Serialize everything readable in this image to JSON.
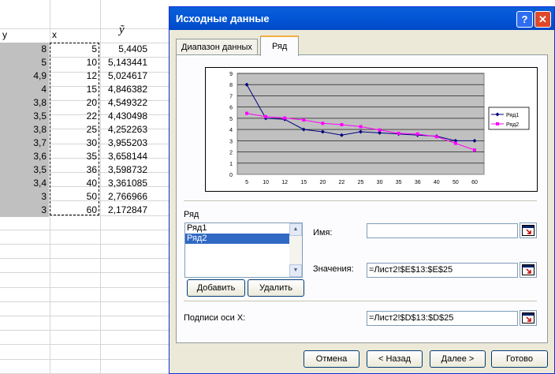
{
  "sheet": {
    "headers": {
      "y": "y",
      "x": "x",
      "yhat": "ỹ"
    },
    "rows": [
      {
        "y": "8",
        "x": "5",
        "yhat": "5,4405"
      },
      {
        "y": "5",
        "x": "10",
        "yhat": "5,143441"
      },
      {
        "y": "4,9",
        "x": "12",
        "yhat": "5,024617"
      },
      {
        "y": "4",
        "x": "15",
        "yhat": "4,846382"
      },
      {
        "y": "3,8",
        "x": "20",
        "yhat": "4,549322"
      },
      {
        "y": "3,5",
        "x": "22",
        "yhat": "4,430498"
      },
      {
        "y": "3,8",
        "x": "25",
        "yhat": "4,252263"
      },
      {
        "y": "3,7",
        "x": "30",
        "yhat": "3,955203"
      },
      {
        "y": "3,6",
        "x": "35",
        "yhat": "3,658144"
      },
      {
        "y": "3,5",
        "x": "36",
        "yhat": "3,598732"
      },
      {
        "y": "3,4",
        "x": "40",
        "yhat": "3,361085"
      },
      {
        "y": "3",
        "x": "50",
        "yhat": "2,766966"
      },
      {
        "y": "3",
        "x": "60",
        "yhat": "2,172847"
      }
    ]
  },
  "dialog": {
    "title": "Исходные данные",
    "help": "?",
    "close": "✕",
    "tabs": [
      "Диапазон данных",
      "Ряд"
    ],
    "series_group_label": "Ряд",
    "series_items": [
      "Ряд1",
      "Ряд2"
    ],
    "selected_series": 1,
    "add_button": "Добавить",
    "remove_button": "Удалить",
    "name_label": "Имя:",
    "name_value": "",
    "values_label": "Значения:",
    "values_value": "=Лист2!$E$13:$E$25",
    "axis_labels_label": "Подписи оси X:",
    "axis_labels_value": "=Лист2!$D$13:$D$25",
    "buttons": {
      "cancel": "Отмена",
      "back": "< Назад",
      "next": "Далее >",
      "finish": "Готово"
    }
  },
  "chart_data": {
    "type": "line",
    "categories": [
      "5",
      "10",
      "12",
      "15",
      "20",
      "22",
      "25",
      "30",
      "35",
      "36",
      "40",
      "50",
      "60"
    ],
    "ylim": [
      0,
      9
    ],
    "yticks": [
      "0",
      "1",
      "2",
      "3",
      "4",
      "5",
      "6",
      "7",
      "8",
      "9"
    ],
    "series": [
      {
        "name": "Ряд1",
        "color": "#000080",
        "values": [
          8,
          5,
          4.9,
          4,
          3.8,
          3.5,
          3.8,
          3.7,
          3.6,
          3.5,
          3.4,
          3,
          3
        ]
      },
      {
        "name": "Ряд2",
        "color": "#ff00ff",
        "values": [
          5.4405,
          5.143441,
          5.024617,
          4.846382,
          4.549322,
          4.430498,
          4.252263,
          3.955203,
          3.658144,
          3.598732,
          3.361085,
          2.766966,
          2.172847
        ]
      }
    ],
    "legend": "right",
    "plot_background": "#c0c0c0",
    "grid": true
  }
}
